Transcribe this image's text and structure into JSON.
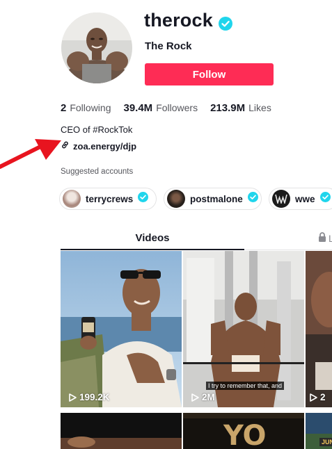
{
  "profile": {
    "username": "therock",
    "display_name": "The Rock",
    "follow_label": "Follow",
    "bio": "CEO of #RockTok",
    "link": "zoa.energy/djp"
  },
  "stats": {
    "following_count": "2",
    "following_label": "Following",
    "followers_count": "39.4M",
    "followers_label": "Followers",
    "likes_count": "213.9M",
    "likes_label": "Likes"
  },
  "suggested": {
    "title": "Suggested accounts",
    "accounts": [
      {
        "name": "terrycrews"
      },
      {
        "name": "postmalone"
      },
      {
        "name": "wwe"
      }
    ]
  },
  "tabs": {
    "videos": "Videos",
    "liked": "L"
  },
  "videos": [
    {
      "views": "199.2K"
    },
    {
      "views": "2M",
      "caption": "I try to remember that, and"
    },
    {
      "views": "2"
    },
    {
      "views": ""
    },
    {
      "views": ""
    },
    {
      "views": "",
      "caption": "JUN"
    }
  ],
  "colors": {
    "accent": "#fe2c55",
    "verified": "#20d5ec",
    "arrow": "#e8141f"
  }
}
